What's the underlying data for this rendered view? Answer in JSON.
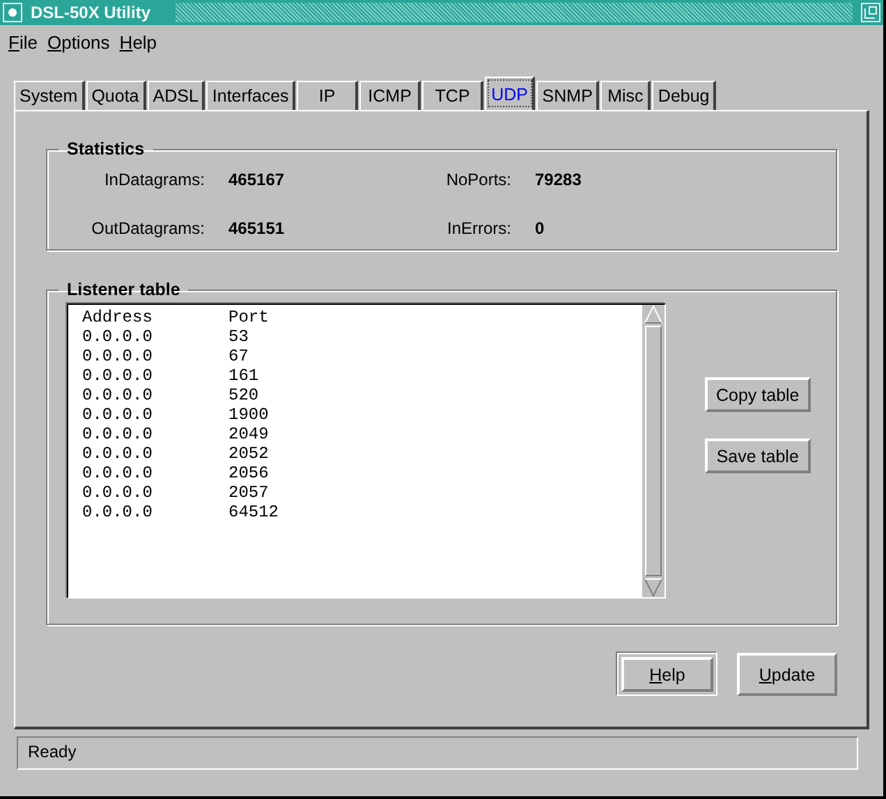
{
  "window": {
    "title": "DSL-50X Utility"
  },
  "menu": [
    {
      "label": "File",
      "mnemonic_underlined": true
    },
    {
      "label": "Options",
      "mnemonic_underlined": true
    },
    {
      "label": "Help",
      "mnemonic_underlined": true
    }
  ],
  "tabs": [
    {
      "label": "System",
      "selected": false
    },
    {
      "label": "Quota",
      "selected": false
    },
    {
      "label": "ADSL",
      "selected": false
    },
    {
      "label": "Interfaces",
      "selected": false
    },
    {
      "label": "IP",
      "selected": false
    },
    {
      "label": "ICMP",
      "selected": false
    },
    {
      "label": "TCP",
      "selected": false
    },
    {
      "label": "UDP",
      "selected": true
    },
    {
      "label": "SNMP",
      "selected": false
    },
    {
      "label": "Misc",
      "selected": false
    },
    {
      "label": "Debug",
      "selected": false
    }
  ],
  "statistics": {
    "title": "Statistics",
    "fields": [
      {
        "label": "InDatagrams:",
        "value": "465167"
      },
      {
        "label": "NoPorts:",
        "value": "79283"
      },
      {
        "label": "OutDatagrams:",
        "value": "465151"
      },
      {
        "label": "InErrors:",
        "value": "0"
      }
    ]
  },
  "listener_table": {
    "title": "Listener table",
    "columns": [
      "Address",
      "Port"
    ],
    "rows": [
      [
        "0.0.0.0",
        "53"
      ],
      [
        "0.0.0.0",
        "67"
      ],
      [
        "0.0.0.0",
        "161"
      ],
      [
        "0.0.0.0",
        "520"
      ],
      [
        "0.0.0.0",
        "1900"
      ],
      [
        "0.0.0.0",
        "2049"
      ],
      [
        "0.0.0.0",
        "2052"
      ],
      [
        "0.0.0.0",
        "2056"
      ],
      [
        "0.0.0.0",
        "2057"
      ],
      [
        "0.0.0.0",
        "64512"
      ]
    ],
    "buttons": [
      "Copy table",
      "Save table"
    ]
  },
  "buttons": [
    {
      "label": "Help",
      "mnemonic_underlined": true,
      "default": true
    },
    {
      "label": "Update",
      "mnemonic_underlined": true,
      "default": false
    }
  ],
  "status_bar": "Ready"
}
